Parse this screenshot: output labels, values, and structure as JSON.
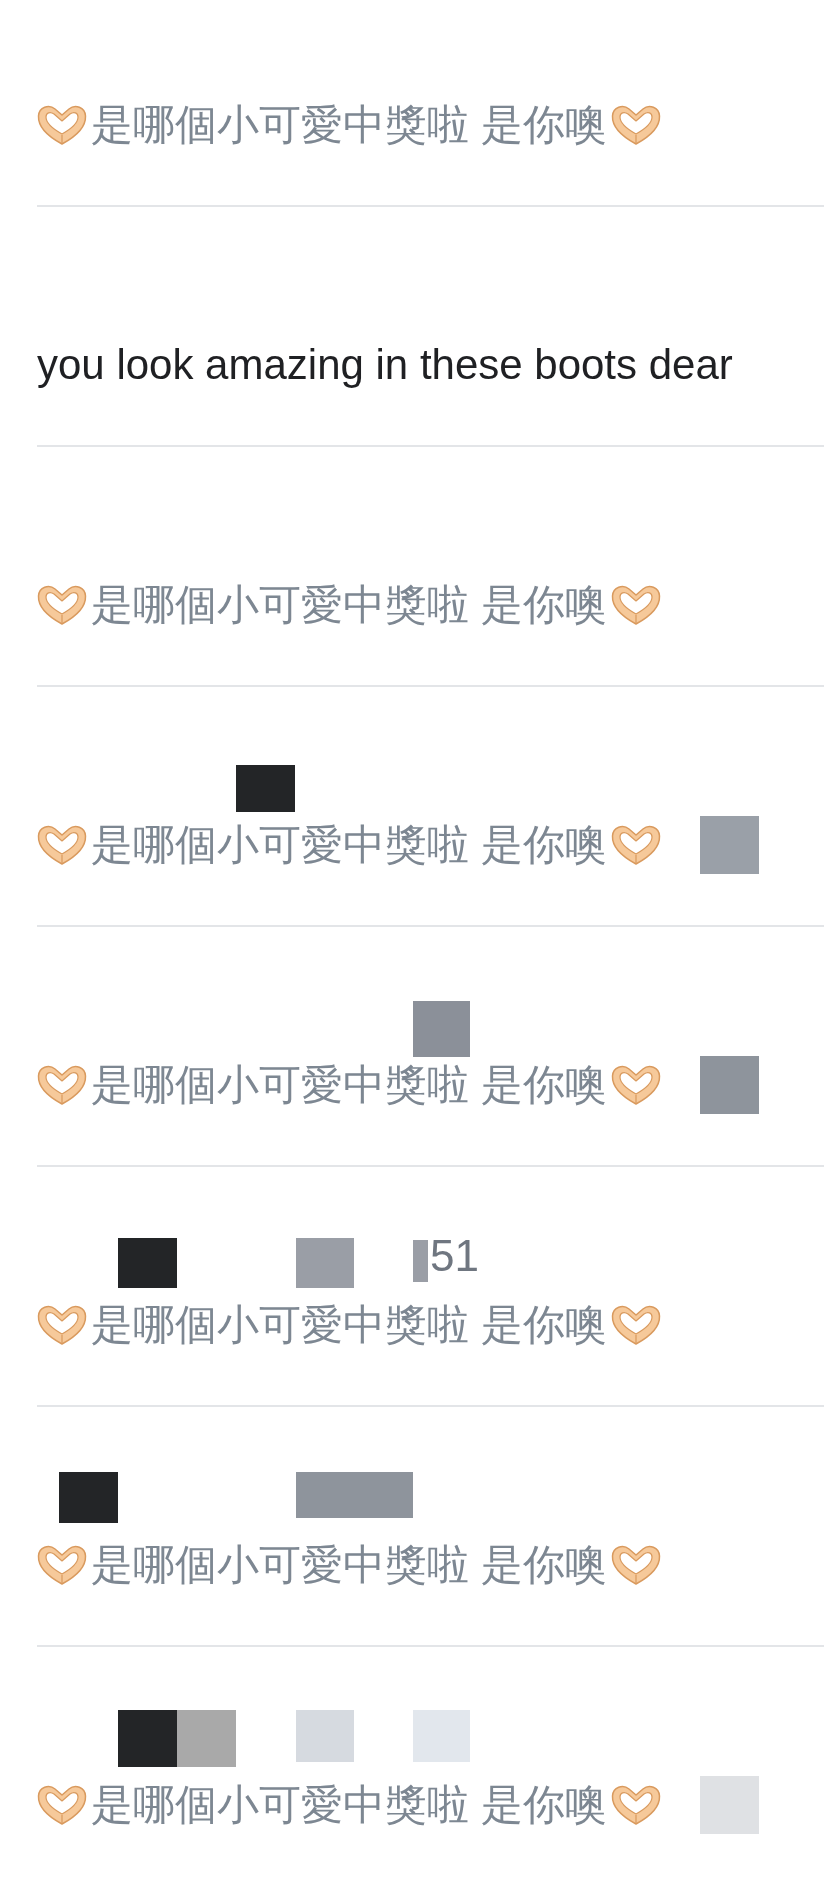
{
  "rows": [
    {
      "message": {
        "muted": true,
        "segments": [
          {
            "kind": "icon"
          },
          {
            "kind": "text",
            "text": "是哪個小可愛中獎啦 是你噢"
          },
          {
            "kind": "icon"
          }
        ]
      }
    },
    {
      "message": {
        "muted": false,
        "segments": [
          {
            "kind": "text",
            "text": "you look amazing in these boots dear"
          }
        ]
      }
    },
    {
      "message": {
        "muted": true,
        "segments": [
          {
            "kind": "icon"
          },
          {
            "kind": "text",
            "text": "是哪個小可愛中獎啦 是你噢"
          },
          {
            "kind": "icon"
          }
        ]
      }
    },
    {
      "header": {
        "redactions": [
          {
            "color": "#232527"
          }
        ]
      },
      "message": {
        "muted": true,
        "segments": [
          {
            "kind": "icon"
          },
          {
            "kind": "text",
            "text": "是哪個小可愛中獎啦 是你噢"
          },
          {
            "kind": "icon"
          }
        ],
        "redaction": {
          "color": "#9aa0a8"
        }
      }
    },
    {
      "header": {
        "redactions": [
          {
            "color": "#8b9099"
          }
        ]
      },
      "message": {
        "muted": true,
        "segments": [
          {
            "kind": "icon"
          },
          {
            "kind": "text",
            "text": "是哪個小可愛中獎啦 是你噢"
          },
          {
            "kind": "icon"
          }
        ],
        "redaction": {
          "color": "#8e949c"
        }
      }
    },
    {
      "header": {
        "redactions": [
          {
            "color": "#232527"
          },
          {
            "color": "#9a9ea6"
          },
          {
            "color": "#9a9ea6"
          }
        ],
        "text": "51"
      },
      "message": {
        "muted": true,
        "segments": [
          {
            "kind": "icon"
          },
          {
            "kind": "text",
            "text": "是哪個小可愛中獎啦 是你噢"
          },
          {
            "kind": "icon"
          }
        ]
      }
    },
    {
      "header": {
        "redactions": [
          {
            "color": "#232527"
          },
          {
            "color": "#8e949c"
          }
        ]
      },
      "message": {
        "muted": true,
        "segments": [
          {
            "kind": "icon"
          },
          {
            "kind": "text",
            "text": "是哪個小可愛中獎啦 是你噢"
          },
          {
            "kind": "icon"
          }
        ]
      }
    },
    {
      "header": {
        "redactions": [
          {
            "color": "#232527"
          },
          {
            "color": "#a9a9a9"
          },
          {
            "color": "#d6dae0"
          },
          {
            "color": "#e2e7ed"
          }
        ]
      },
      "message": {
        "muted": true,
        "segments": [
          {
            "kind": "icon"
          },
          {
            "kind": "text",
            "text": "是哪個小可愛中獎啦 是你噢"
          },
          {
            "kind": "icon"
          }
        ],
        "redaction": {
          "color": "#dfe1e4"
        }
      }
    }
  ]
}
